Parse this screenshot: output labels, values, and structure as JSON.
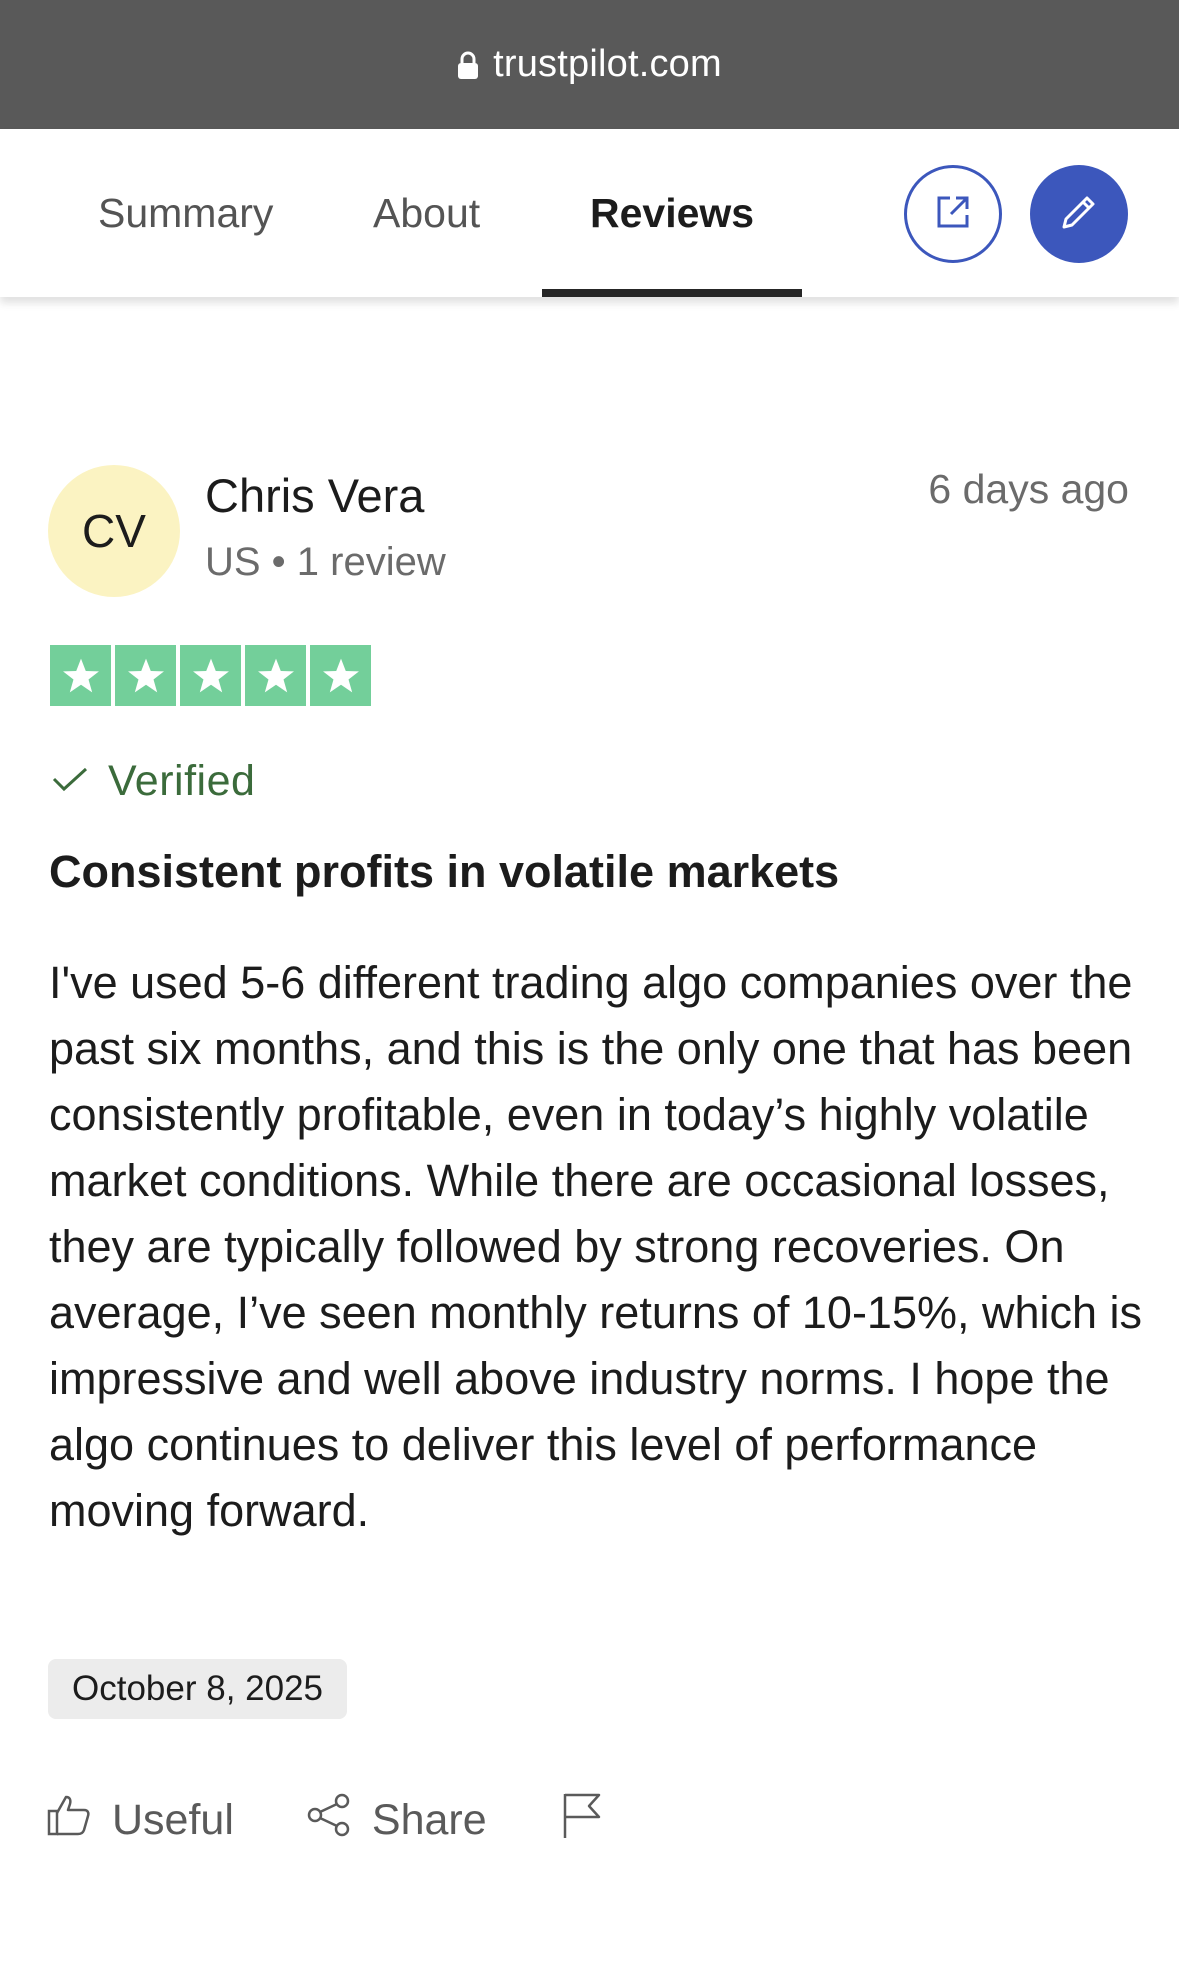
{
  "browser": {
    "url": "trustpilot.com",
    "lock_icon": "lock-icon"
  },
  "nav": {
    "tabs": [
      {
        "label": "Summary",
        "active": false
      },
      {
        "label": "About",
        "active": false
      },
      {
        "label": "Reviews",
        "active": true
      }
    ],
    "open_icon": "external-link-icon",
    "write_icon": "pencil-icon"
  },
  "review": {
    "avatar_initials": "CV",
    "reviewer_name": "Chris Vera",
    "reviewer_meta": "US • 1 review",
    "relative_date": "6 days ago",
    "rating": 5,
    "verified_label": "Verified",
    "title": "Consistent profits in volatile markets",
    "body": "I've used 5-6 different trading algo companies over the past six months, and this is the only one that has been consistently profitable, even in today’s highly volatile market conditions. While there are occasional losses, they are typically followed by strong recoveries. On average, I’ve seen monthly returns of 10-15%, which is impressive and well above industry norms. I hope the algo continues to deliver this level of performance moving forward.",
    "date_of_experience": "October 8, 2025"
  },
  "actions": {
    "useful_label": "Useful",
    "share_label": "Share"
  },
  "colors": {
    "star_green": "#73cf9a",
    "accent_blue": "#3c57bc",
    "verified_green": "#3b6b3b",
    "avatar_bg": "#fbf3c2"
  }
}
